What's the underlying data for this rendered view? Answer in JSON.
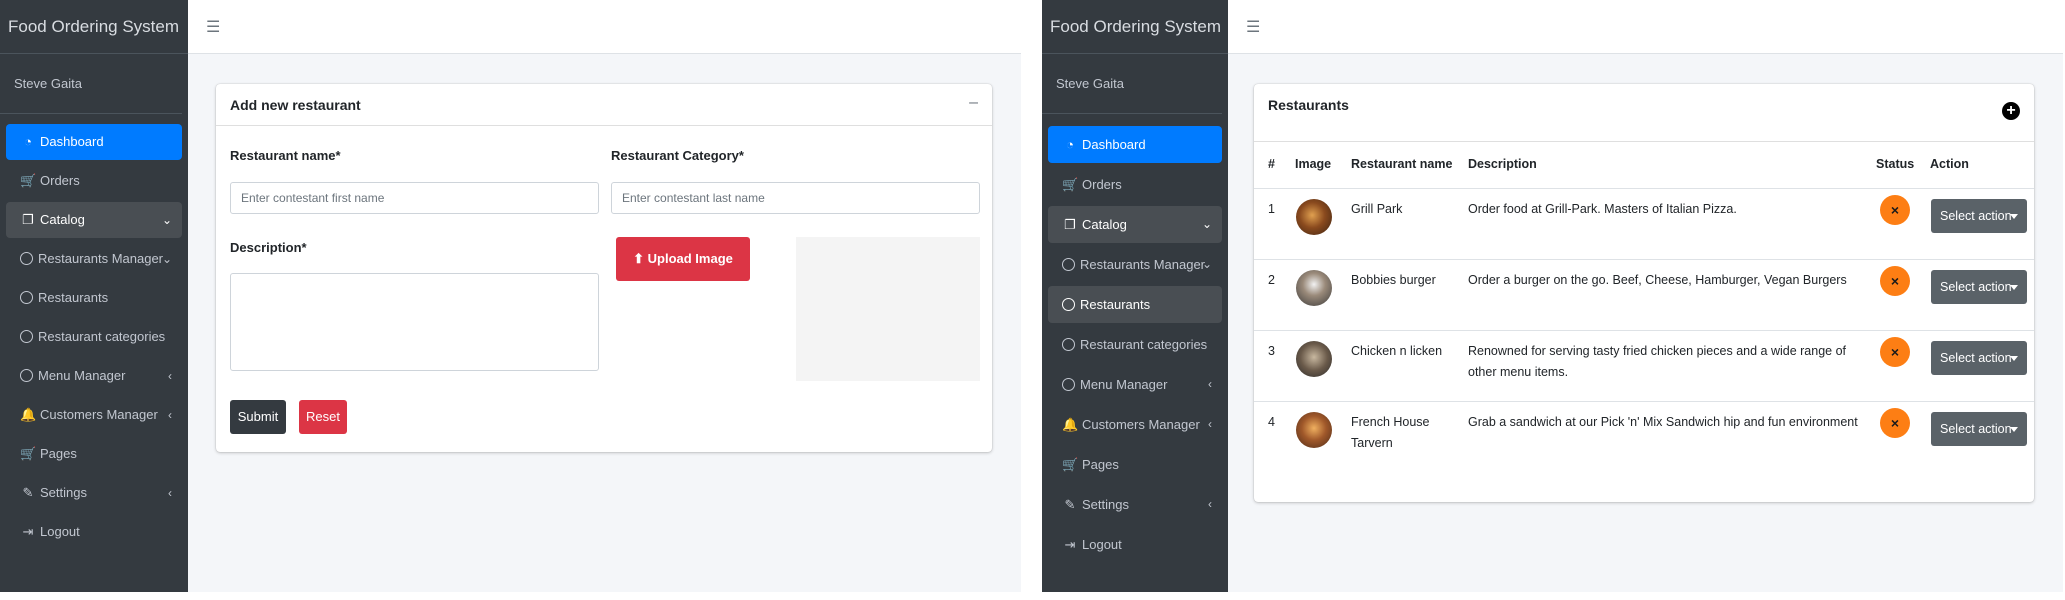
{
  "app": {
    "brand": "Food Ordering System",
    "user": "Steve Gaita",
    "menu_icon": "☰"
  },
  "sidebar": {
    "items": [
      {
        "label": "Dashboard",
        "icon": "dashboard-icon"
      },
      {
        "label": "Orders",
        "icon": "cart-icon"
      },
      {
        "label": "Catalog",
        "icon": "copy-icon"
      },
      {
        "label": "Restaurants Manager",
        "icon": "circle-icon"
      },
      {
        "label": "Restaurants",
        "icon": "circle-icon"
      },
      {
        "label": "Restaurant categories",
        "icon": "circle-icon"
      },
      {
        "label": "Menu Manager",
        "icon": "circle-icon"
      },
      {
        "label": "Customers Manager",
        "icon": "bell-icon"
      },
      {
        "label": "Pages",
        "icon": "cart-icon"
      },
      {
        "label": "Settings",
        "icon": "edit-icon"
      },
      {
        "label": "Logout",
        "icon": "sign-out-icon"
      }
    ]
  },
  "form": {
    "title": "Add new restaurant",
    "collapse": "–",
    "name_label": "Restaurant name*",
    "name_placeholder": "Enter contestant first name",
    "category_label": "Restaurant Category*",
    "category_placeholder": "Enter contestant last name",
    "description_label": "Description*",
    "upload_label": "Upload Image",
    "submit_label": "Submit",
    "reset_label": "Reset"
  },
  "restaurants": {
    "title": "Restaurants",
    "add_icon": "+",
    "columns": [
      "#",
      "Image",
      "Restaurant name",
      "Description",
      "Status",
      "Action"
    ],
    "rows": [
      {
        "num": "1",
        "name": "Grill Park",
        "description": "Order food at Grill-Park. Masters of Italian Pizza.",
        "status": "×",
        "action": "Select action"
      },
      {
        "num": "2",
        "name": "Bobbies burger",
        "description": "Order a burger on the go. Beef, Cheese, Hamburger, Vegan Burgers",
        "status": "×",
        "action": "Select action"
      },
      {
        "num": "3",
        "name": "Chicken n licken",
        "description": "Renowned for serving tasty fried chicken pieces and a wide range of other menu items.",
        "status": "×",
        "action": "Select action"
      },
      {
        "num": "4",
        "name": "French House Tarvern",
        "description": "Grab a sandwich at our Pick 'n' Mix Sandwich hip and fun environment",
        "status": "×",
        "action": "Select action"
      }
    ]
  },
  "colors": {
    "sidebar_bg": "#343a40",
    "active_bg": "#007bff",
    "danger": "#dc3545",
    "status_orange": "#fd7e14"
  }
}
